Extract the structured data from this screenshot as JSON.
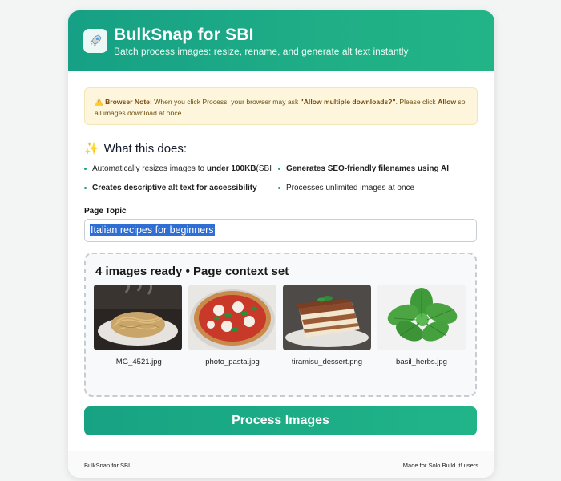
{
  "header": {
    "title": "BulkSnap for SBI",
    "subtitle": "Batch process images: resize, rename, and generate alt text instantly",
    "logo_icon": "rocket-icon"
  },
  "note": {
    "icon": "warning-icon",
    "label": "Browser Note:",
    "text1": " When you click Process, your browser may ask ",
    "quote": "\"Allow multiple downloads?\"",
    "text2": ". Please click ",
    "allow": "Allow",
    "text3": " so all images download at once."
  },
  "features": {
    "title": "What this does:",
    "icon": "sparkles-icon",
    "items": [
      {
        "prefix": "Automatically resizes images to ",
        "bold": "under 100KB",
        "suffix": " (SBI"
      },
      {
        "text": "Generates SEO-friendly filenames using AI"
      },
      {
        "text": "Creates descriptive alt text for accessibility"
      },
      {
        "text": "Processes unlimited images at once"
      }
    ]
  },
  "topic": {
    "label": "Page Topic",
    "value": "Italian recipes for beginners"
  },
  "images": {
    "status": "4 images ready • Page context set",
    "files": [
      "IMG_4521.jpg",
      "photo_pasta.jpg",
      "tiramisu_dessert.png",
      "basil_herbs.jpg"
    ]
  },
  "process_button": "Process Images",
  "footer": {
    "left": "BulkSnap for SBI",
    "right": "Made for Solo Build It! users"
  },
  "colors": {
    "accent": "#1fae86",
    "note_bg": "#fdf6dd",
    "selection": "#2f6fd4"
  }
}
